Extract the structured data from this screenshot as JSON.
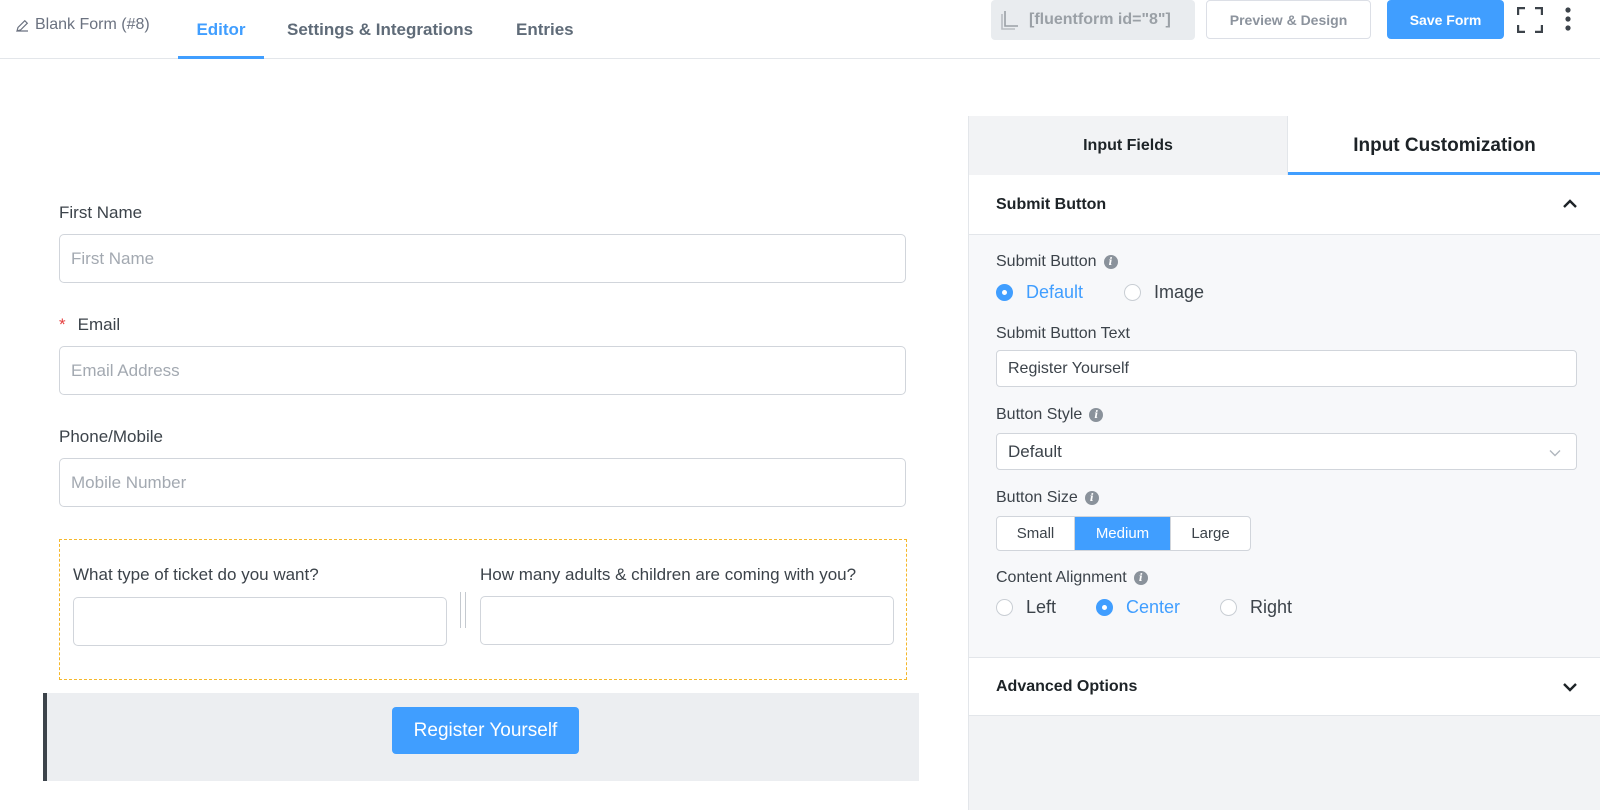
{
  "topbar": {
    "form_title": "Blank Form (#8)",
    "tabs": [
      {
        "label": "Editor",
        "active": true
      },
      {
        "label": "Settings & Integrations",
        "active": false
      },
      {
        "label": "Entries",
        "active": false
      }
    ],
    "shortcode": "[fluentform id=\"8\"]",
    "preview_label": "Preview & Design",
    "save_label": "Save Form"
  },
  "form": {
    "first_name": {
      "label": "First Name",
      "placeholder": "First Name"
    },
    "email": {
      "required_mark": "*",
      "label": "Email",
      "placeholder": "Email Address"
    },
    "phone": {
      "label": "Phone/Mobile",
      "placeholder": "Mobile Number"
    },
    "container": {
      "col1_label": "What type of ticket do you want?",
      "col2_label": "How many adults & children are coming with you?"
    },
    "submit_label": "Register Yourself"
  },
  "panel": {
    "tabs": [
      {
        "label": "Input Fields",
        "active": false
      },
      {
        "label": "Input Customization",
        "active": true
      }
    ],
    "submit_section": {
      "title": "Submit Button",
      "submit_button_label": "Submit Button",
      "submit_button_options": [
        {
          "label": "Default",
          "selected": true
        },
        {
          "label": "Image",
          "selected": false
        }
      ],
      "text_label": "Submit Button Text",
      "text_value": "Register Yourself",
      "style_label": "Button Style",
      "style_value": "Default",
      "size_label": "Button Size",
      "sizes": [
        {
          "label": "Small",
          "selected": false
        },
        {
          "label": "Medium",
          "selected": true
        },
        {
          "label": "Large",
          "selected": false
        }
      ],
      "alignment_label": "Content Alignment",
      "alignments": [
        {
          "label": "Left",
          "selected": false
        },
        {
          "label": "Center",
          "selected": true
        },
        {
          "label": "Right",
          "selected": false
        }
      ]
    },
    "advanced_title": "Advanced Options"
  },
  "colors": {
    "accent": "#409eff",
    "required": "#e53e3e",
    "container_border": "#f5b72a"
  },
  "icons": [
    "pencil-icon",
    "copy-icon",
    "fullscreen-icon",
    "more-vertical-icon",
    "info-icon",
    "chevron-up-icon",
    "chevron-down-icon"
  ]
}
